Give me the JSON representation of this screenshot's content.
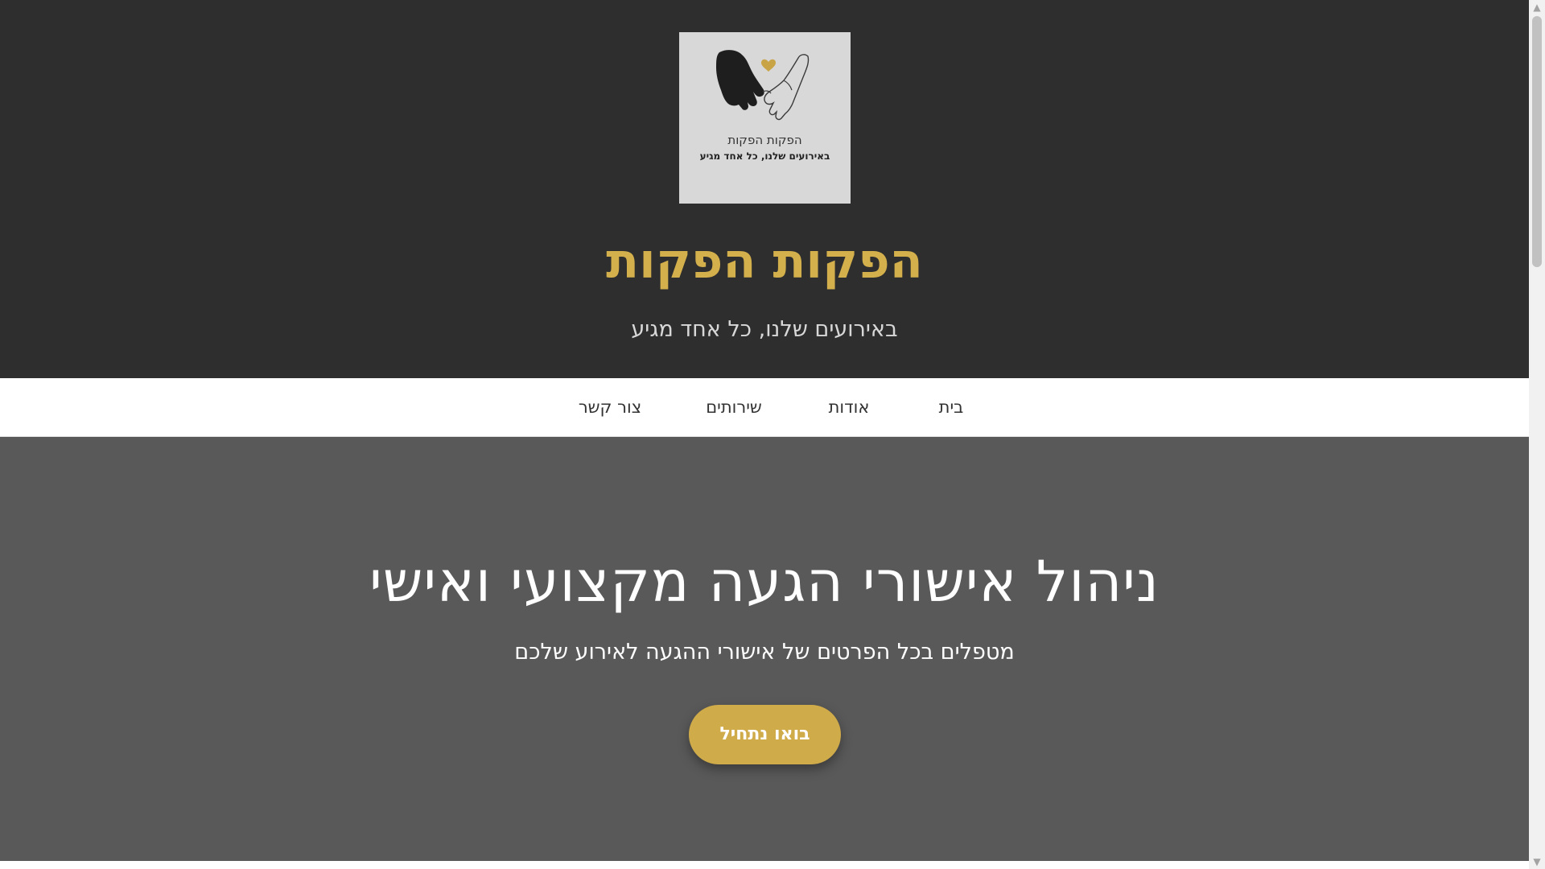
{
  "header": {
    "logo": {
      "line1": "הפקות הפקות",
      "line2": "באירועים שלנו, כל אחד מגיע"
    },
    "title": "הפקות הפקות",
    "tagline": "באירועים שלנו, כל אחד מגיע"
  },
  "nav": {
    "items": [
      {
        "label": "בית"
      },
      {
        "label": "אודות"
      },
      {
        "label": "שירותים"
      },
      {
        "label": "צור קשר"
      }
    ]
  },
  "hero": {
    "title": "ניהול אישורי הגעה מקצועי ואישי",
    "subtitle": "מטפלים בכל הפרטים של אישורי ההגעה לאירוע שלכם",
    "cta_label": "בואו נתחיל"
  },
  "colors": {
    "header_bg": "#2e2e2e",
    "accent_gold": "#d4b04c",
    "hero_bg": "#595959",
    "nav_bg": "#ffffff"
  },
  "icons": {
    "logo": "holding-hands-heart-logo",
    "scroll_up": "triangle-up-icon",
    "scroll_down": "triangle-down-icon"
  }
}
